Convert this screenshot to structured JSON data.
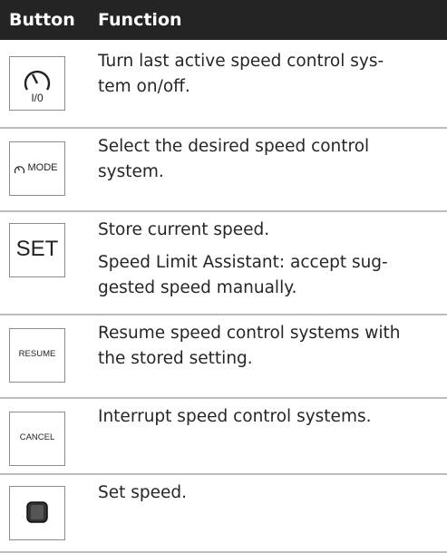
{
  "table": {
    "header": {
      "button": "Button",
      "function": "Function"
    },
    "rows": [
      {
        "icon": "speedometer-on-off-icon",
        "icon_text": "I/0",
        "lines": [
          "Turn last active speed control sys-",
          "tem on/off."
        ],
        "extra": ""
      },
      {
        "icon": "mode-button-icon",
        "icon_text": "MODE",
        "lines": [
          "Select the desired speed control",
          "system."
        ],
        "extra": ""
      },
      {
        "icon": "set-button-icon",
        "icon_text": "SET",
        "lines": [
          "Store current speed."
        ],
        "extra": [
          "Speed Limit Assistant: accept sug-",
          "gested speed manually."
        ]
      },
      {
        "icon": "resume-button-icon",
        "icon_text": "RESUME",
        "lines": [
          "Resume speed control systems with",
          "the stored setting."
        ],
        "extra": ""
      },
      {
        "icon": "cancel-button-icon",
        "icon_text": "CANCEL",
        "lines": [
          "Interrupt speed control systems."
        ],
        "extra": ""
      },
      {
        "icon": "rocker-switch-icon",
        "icon_text": "",
        "lines": [
          "Set speed."
        ],
        "extra": ""
      }
    ]
  }
}
